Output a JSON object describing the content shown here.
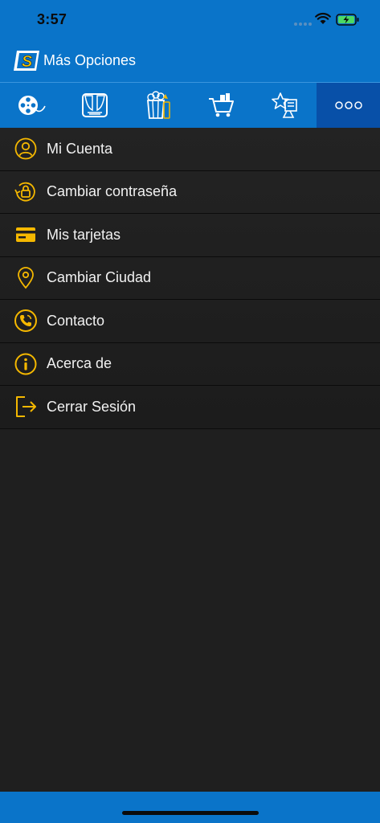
{
  "status_bar": {
    "time": "3:57"
  },
  "header": {
    "title": "Más Opciones",
    "logo_letter": "S"
  },
  "tabs": [
    {
      "name": "tab-movies",
      "icon": "film-reel-icon"
    },
    {
      "name": "tab-theaters",
      "icon": "theater-curtain-icon"
    },
    {
      "name": "tab-snacks",
      "icon": "popcorn-icon"
    },
    {
      "name": "tab-cart",
      "icon": "shopping-cart-icon"
    },
    {
      "name": "tab-promotions",
      "icon": "star-ticket-icon"
    },
    {
      "name": "tab-more",
      "icon": "more-dots-icon"
    }
  ],
  "menu": [
    {
      "label": "Mi Cuenta",
      "icon": "user-icon"
    },
    {
      "label": "Cambiar contraseña",
      "icon": "lock-refresh-icon"
    },
    {
      "label": "Mis tarjetas",
      "icon": "credit-card-icon"
    },
    {
      "label": "Cambiar Ciudad",
      "icon": "map-pin-icon"
    },
    {
      "label": "Contacto",
      "icon": "phone-icon"
    },
    {
      "label": "Acerca de",
      "icon": "info-icon"
    },
    {
      "label": "Cerrar Sesión",
      "icon": "logout-icon"
    }
  ],
  "colors": {
    "primary": "#0a74c9",
    "active_tab": "#0850a8",
    "accent": "#f5b800",
    "background": "#1f1f1f"
  }
}
